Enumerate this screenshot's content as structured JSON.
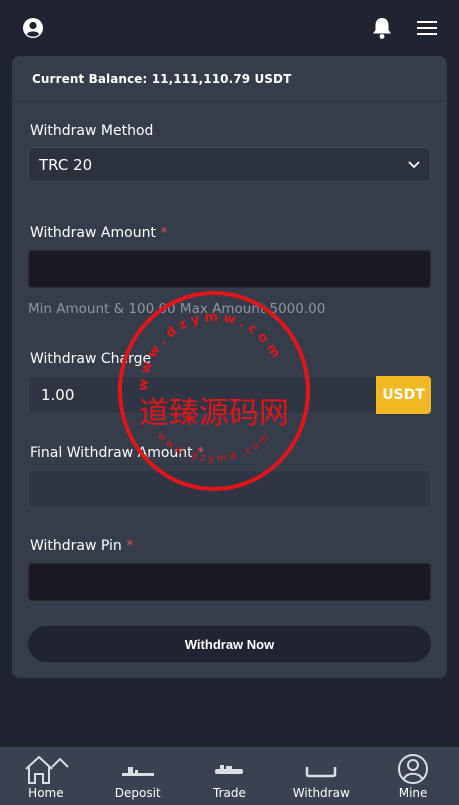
{
  "header": {
    "profile_icon": "user-circle-icon",
    "bell_icon": "bell-icon",
    "menu_icon": "hamburger-menu-icon"
  },
  "balance": {
    "text": "Current Balance: 11,111,110.79 USDT"
  },
  "form": {
    "method_label": "Withdraw Method",
    "method_value": "TRC 20",
    "amount_label": "Withdraw Amount",
    "required_mark": "*",
    "amount_value": "",
    "amount_hint": "Min Amount & 100.00 Max Amount 5000.00",
    "charge_label": "Withdraw Charge",
    "charge_value": "1.00",
    "charge_currency": "USDT",
    "final_label": "Final Withdraw Amount",
    "final_value": "",
    "pin_label": "Withdraw Pin",
    "pin_value": "",
    "submit_label": "Withdraw Now"
  },
  "watermark": {
    "main_text": "道臻源码网",
    "ring_text_top": "w w w . d z y m w . c o m",
    "ring_text_bottom": "w w w . d z y m w . c o m",
    "color": "#e0161b"
  },
  "nav": {
    "items": [
      {
        "label": "Home",
        "icon": "home-icon"
      },
      {
        "label": "Deposit",
        "icon": "deposit-icon"
      },
      {
        "label": "Trade",
        "icon": "trade-icon"
      },
      {
        "label": "Withdraw",
        "icon": "withdraw-icon"
      },
      {
        "label": "Mine",
        "icon": "mine-user-icon"
      }
    ]
  },
  "colors": {
    "background": "#1f2430",
    "card": "#353c4a",
    "accent": "#f2b823",
    "required": "#e84a5f"
  }
}
